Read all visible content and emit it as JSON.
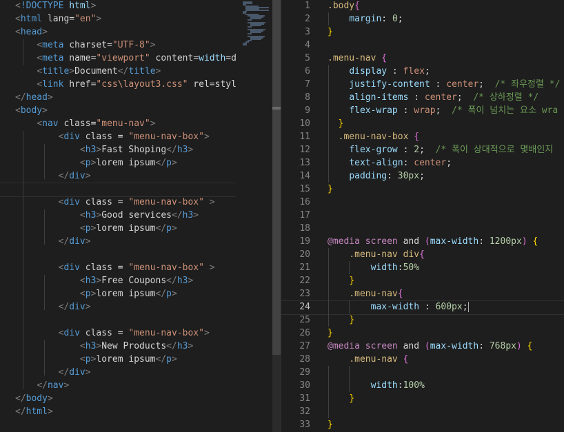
{
  "html_file": {
    "lines": [
      "<!DOCTYPE html>",
      "<html lang=\"en\">",
      "<head>",
      "    <meta charset=\"UTF-8\">",
      "    <meta name=\"viewport\" content=\"width=d",
      "    <title>Document</title>",
      "    <link href=\"css\\layout3.css\" rel=\"styl",
      "</head>",
      "<body>",
      "    <nav class=\"menu-nav\">",
      "        <div class = \"menu-nav-box\">",
      "            <h3>Fast Shoping</h3>",
      "            <p>lorem ipsum</p>",
      "        </div>",
      "",
      "        <div class = \"menu-nav-box\" >",
      "            <h3>Good services</h3>",
      "            <p>lorem ipsum</p>",
      "        </div>",
      "",
      "        <div class = \"menu-nav-box\" >",
      "            <h3>Free Coupons</h3>",
      "            <p>lorem ipsum</p>",
      "        </div>",
      "",
      "        <div class = \"menu-nav-box\">",
      "            <h3>New Products</h3>",
      "            <p>lorem ipsum</p>",
      "        </div>",
      "    </nav>",
      "</body>",
      "</html>"
    ]
  },
  "css_file": {
    "current_line": 24,
    "line_numbers": [
      "1",
      "2",
      "3",
      "4",
      "5",
      "6",
      "7",
      "8",
      "9",
      "10",
      "11",
      "12",
      "13",
      "14",
      "15",
      "16",
      "17",
      "18",
      "19",
      "20",
      "21",
      "22",
      "23",
      "24",
      "25",
      "26",
      "27",
      "28",
      "29",
      "30",
      "31",
      "32",
      "33"
    ],
    "lines": [
      ".body{",
      "    margin: 0;",
      "}",
      "",
      ".menu-nav {",
      "    display : flex;",
      "    justify-content : center;  /* 좌우정렬 */",
      "    align-items : center;  /* 상하정렬 */",
      "    flex-wrap : wrap;  /* 폭이 넘치는 요소 wra",
      "  }",
      "  .menu-nav-box {",
      "    flex-grow : 2;  /* 폭이 상대적으로 몇배인지",
      "    text-align: center;",
      "    padding: 30px;",
      "}",
      "",
      "",
      "",
      "@media screen and (max-width: 1200px) {",
      "    .menu-nav div{",
      "        width:50%",
      "    }",
      "    .menu-nav{",
      "        max-width : 600px;",
      "    }",
      "}",
      "@media screen and (max-width: 768px) {",
      "    .menu-nav {",
      "",
      "        width:100%",
      "    }",
      "",
      "}"
    ]
  }
}
